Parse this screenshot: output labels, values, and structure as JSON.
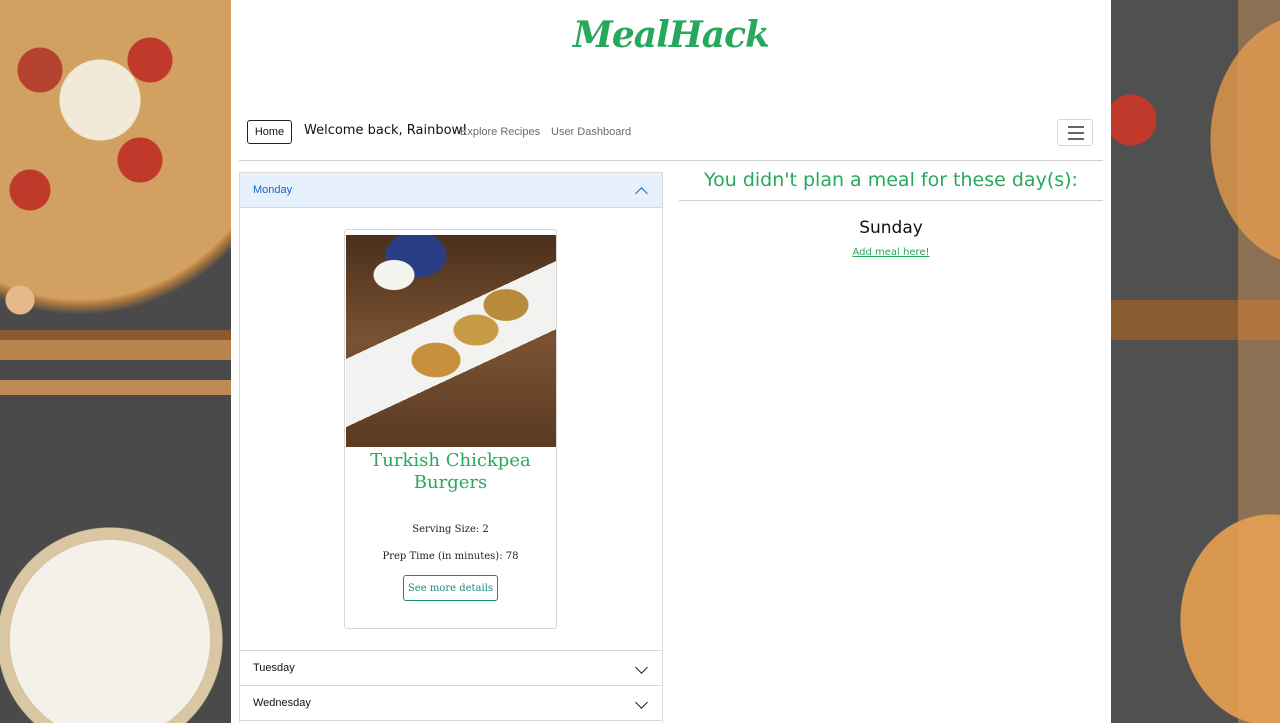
{
  "brand": "MealHack",
  "nav": {
    "home": "Home",
    "welcome": "Welcome back, Rainbow!",
    "explore": "Explore Recipes",
    "dashboard": "User Dashboard"
  },
  "accordion": {
    "items": [
      {
        "label": "Monday",
        "expanded": true
      },
      {
        "label": "Tuesday",
        "expanded": false
      },
      {
        "label": "Wednesday",
        "expanded": false
      }
    ]
  },
  "recipe_card": {
    "title": "Turkish Chickpea Burgers",
    "serving": "Serving Size: 2",
    "prep": "Prep Time (in minutes): 78",
    "button": "See more details"
  },
  "unplanned": {
    "title": "You didn't plan a meal for these day(s):",
    "days": [
      {
        "day": "Sunday",
        "link": "Add meal here!"
      }
    ]
  },
  "colors": {
    "brand_green": "#27a85c",
    "accordion_active_bg": "#e7f0fd",
    "accordion_active_text": "#1c63c9",
    "button_teal": "#1a8a78"
  }
}
